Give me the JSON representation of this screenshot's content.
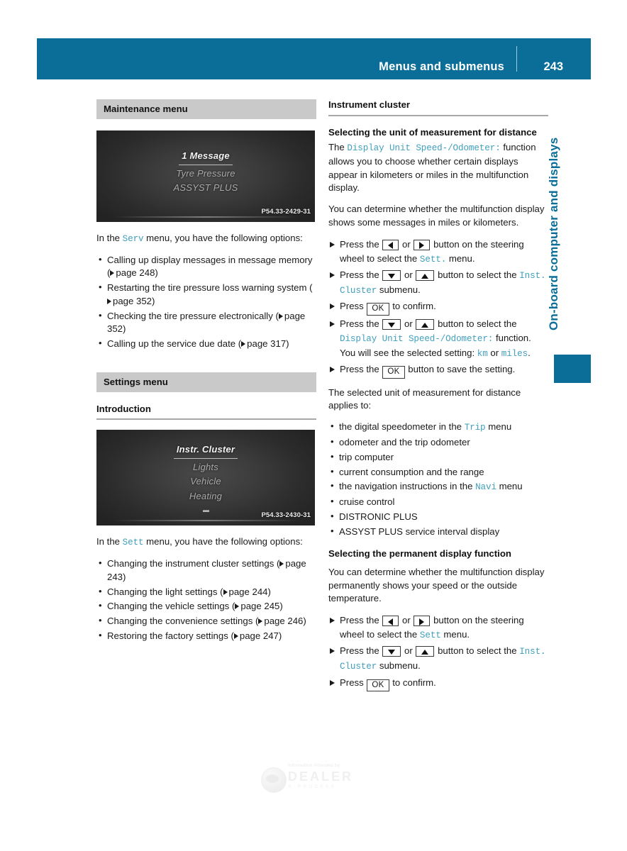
{
  "header": {
    "title": "Menus and submenus",
    "page_number": "243"
  },
  "side_tab": {
    "label": "On-board computer and displays"
  },
  "colors": {
    "brand_blue": "#0b6e99",
    "mono_teal": "#3f9fbd",
    "gray_bar": "#c9c9c9"
  },
  "left_column": {
    "maintenance": {
      "heading": "Maintenance menu",
      "photo": {
        "rows": [
          "1 Message",
          "Tyre Pressure",
          "ASSYST PLUS"
        ],
        "selected_index": 0,
        "code": "P54.33-2429-31"
      },
      "intro_before": "In the ",
      "intro_mono": "Serv",
      "intro_after": " menu, you have the following options:",
      "options": [
        {
          "text": "Calling up display messages in message memory ",
          "page_label": "page 248"
        },
        {
          "text": "Restarting the tire pressure loss warning system ",
          "page_label": "page 352"
        },
        {
          "text": "Checking the tire pressure electronically ",
          "page_label": "page 352"
        },
        {
          "text": "Calling up the service due date ",
          "page_label": "page 317"
        }
      ]
    },
    "settings": {
      "heading": "Settings menu",
      "subheading": "Introduction",
      "photo": {
        "rows": [
          "Instr. Cluster",
          "Lights",
          "Vehicle",
          "Heating"
        ],
        "selected_index": 0,
        "code": "P54.33-2430-31"
      },
      "intro_before": "In the ",
      "intro_mono": "Sett",
      "intro_after": " menu, you have the following options:",
      "options": [
        {
          "text": "Changing the instrument cluster settings ",
          "page_label": "page 243"
        },
        {
          "text": "Changing the light settings ",
          "page_label": "page 244"
        },
        {
          "text": "Changing the vehicle settings ",
          "page_label": "page 245"
        },
        {
          "text": "Changing the convenience settings ",
          "page_label": "page 246"
        },
        {
          "text": "Restoring the factory settings ",
          "page_label": "page 247"
        }
      ]
    }
  },
  "right_column": {
    "heading": "Instrument cluster",
    "unit_section": {
      "subheading": "Selecting the unit of measurement for distance",
      "para1_before": "The ",
      "para1_mono": "Display Unit Speed-/Odometer:",
      "para1_after": " function allows you to choose whether certain displays appear in kilometers or miles in the multifunction display.",
      "para2": "You can determine whether the multifunction display shows some messages in miles or kilometers.",
      "steps": [
        {
          "before": "Press the ",
          "key1": "left-arrow",
          "mid": " or ",
          "key2": "right-arrow",
          "after": " button on the steering wheel to select the ",
          "mono": "Sett.",
          "tail": " menu."
        },
        {
          "before": "Press the ",
          "key1": "down-arrow",
          "mid": " or ",
          "key2": "up-arrow",
          "after": " button to select the ",
          "mono": "Inst. Cluster",
          "tail": " submenu."
        },
        {
          "before": "Press ",
          "key1": "OK",
          "after": " to confirm."
        },
        {
          "before": "Press the ",
          "key1": "down-arrow",
          "mid": " or ",
          "key2": "up-arrow",
          "after": " button to select the ",
          "mono": "Display Unit Speed-/Odometer:",
          "tail": " function.",
          "extra_before": "You will see the selected setting: ",
          "extra_mono1": "km",
          "extra_mid": " or ",
          "extra_mono2": "miles",
          "extra_tail": "."
        },
        {
          "before": "Press the ",
          "key1": "OK",
          "after": " button to save the setting."
        }
      ],
      "applies_intro": "The selected unit of measurement for distance applies to:",
      "applies_items": [
        {
          "before": "the digital speedometer in the ",
          "mono": "Trip",
          "after": " menu"
        },
        {
          "before": "odometer and the trip odometer"
        },
        {
          "before": "trip computer"
        },
        {
          "before": "current consumption and the range"
        },
        {
          "before": "the navigation instructions in the ",
          "mono": "Navi",
          "after": " menu"
        },
        {
          "before": "cruise control"
        },
        {
          "before": "DISTRONIC PLUS"
        },
        {
          "before": "ASSYST PLUS service interval display"
        }
      ]
    },
    "permanent_section": {
      "subheading": "Selecting the permanent display function",
      "para1": "You can determine whether the multifunction display permanently shows your speed or the outside temperature.",
      "steps": [
        {
          "before": "Press the ",
          "key1": "left-arrow",
          "mid": " or ",
          "key2": "right-arrow",
          "after": " button on the steering wheel to select the ",
          "mono": "Sett",
          "tail": " menu."
        },
        {
          "before": "Press the ",
          "key1": "down-arrow",
          "mid": " or ",
          "key2": "up-arrow",
          "after": " button to select the ",
          "mono": "Inst. Cluster",
          "tail": " submenu."
        },
        {
          "before": "Press ",
          "key1": "OK",
          "after": " to confirm."
        }
      ]
    }
  },
  "watermark": {
    "provided_by": "Information Provided by:",
    "brand": "DEALER",
    "sub": "E-PROCESS"
  }
}
